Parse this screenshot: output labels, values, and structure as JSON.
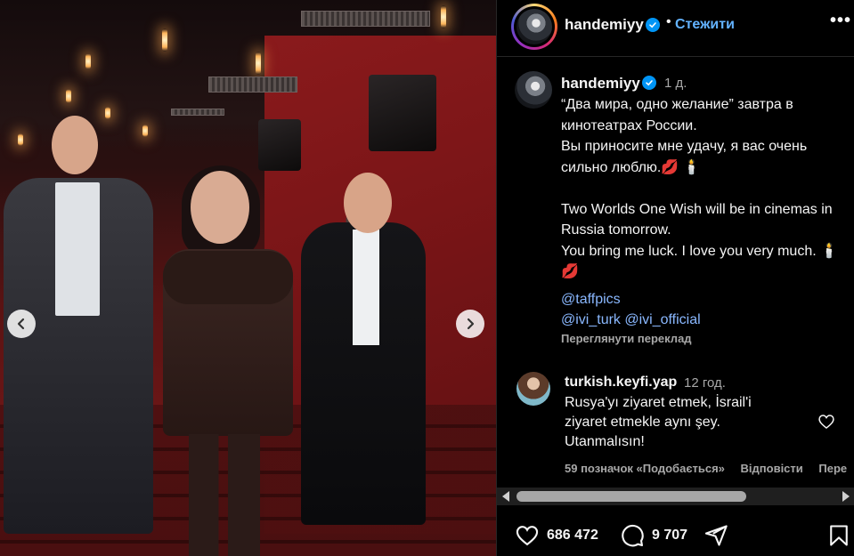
{
  "post": {
    "media_description": "Photo of the premiere at a cinema",
    "author": {
      "username": "handemiyy",
      "verified": true
    },
    "header": {
      "separator": "•",
      "follow_label": "Стежити",
      "more_label": "•••"
    },
    "caption": {
      "username": "handemiyy",
      "time": "1 д.",
      "text": "“Два мира, одно желание” завтра в кинотеатрах России.\nВы приносите мне удачу, я вас очень сильно люблю.💋 🕯️\n\nTwo Worlds One Wish will be in cinemas in Russia tomorrow.\nYou bring me luck. I love you very much. 🕯️ 💋",
      "mentions": [
        "@taffpics",
        "@ivi_turk @ivi_official"
      ],
      "translate_label": "Переглянути переклад"
    },
    "comment": {
      "username": "turkish.keyfi.yap",
      "time": "12 год.",
      "text": "Rusya'yı ziyaret etmek, İsrail'i ziyaret etmekle aynı şey. Utanmalısın!",
      "likes_label": "59 позначок «Подобається»",
      "reply_label": "Відповісти",
      "more_label": "Пере"
    },
    "stats": {
      "likes": "686 472",
      "comments": "9 707"
    },
    "scrollbar": {
      "thumb_fraction": 0.72
    },
    "colors": {
      "accent": "#0095f6",
      "follow": "#63b3ff",
      "mention": "#8ab8ff",
      "muted": "#a8a8a8"
    },
    "icons": {
      "heart": "heart-icon",
      "comment": "comment-icon",
      "share": "share-icon",
      "save": "bookmark-icon"
    }
  }
}
